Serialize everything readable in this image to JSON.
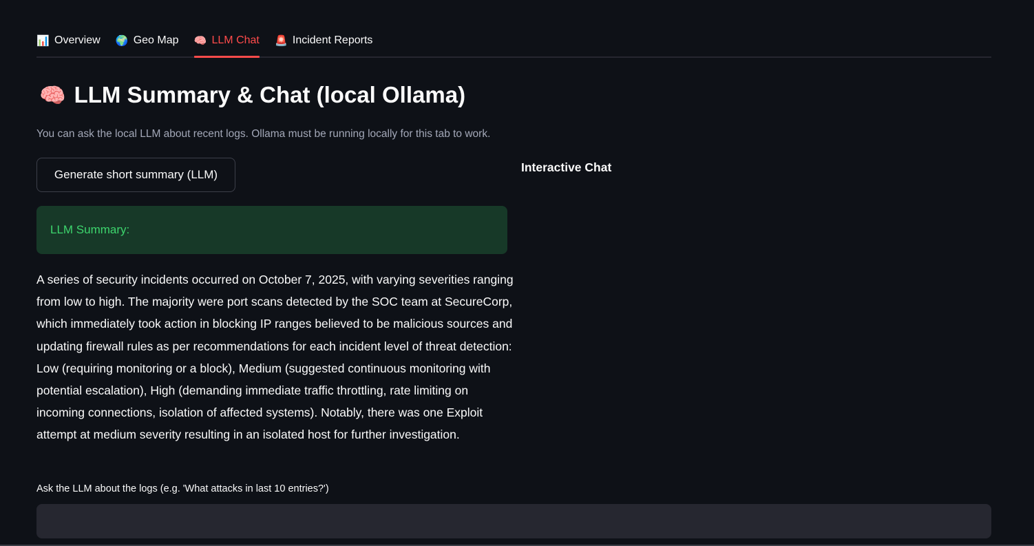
{
  "tabs": [
    {
      "icon": "bar-chart-icon",
      "glyph": "📊",
      "label": "Overview",
      "active": false
    },
    {
      "icon": "globe-icon",
      "glyph": "🌍",
      "label": "Geo Map",
      "active": false
    },
    {
      "icon": "brain-icon",
      "glyph": "🧠",
      "label": "LLM Chat",
      "active": true
    },
    {
      "icon": "siren-icon",
      "glyph": "🚨",
      "label": "Incident Reports",
      "active": false
    }
  ],
  "header": {
    "icon_glyph": "🧠",
    "title": "LLM Summary & Chat (local Ollama)",
    "caption": "You can ask the local LLM about recent logs. Ollama must be running locally for this tab to work."
  },
  "summary": {
    "button_label": "Generate short summary (LLM)",
    "box_label": "LLM Summary:",
    "text": "A series of security incidents occurred on October 7, 2025, with varying severities ranging from low to high. The majority were port scans detected by the SOC team at SecureCorp, which immediately took action in blocking IP ranges believed to be malicious sources and updating firewall rules as per recommendations for each incident level of threat detection: Low (requiring monitoring or a block), Medium (suggested continuous monitoring with potential escalation), High (demanding immediate traffic throttling, rate limiting on incoming connections, isolation of affected systems). Notably, there was one Exploit attempt at medium severity resulting in an isolated host for further investigation."
  },
  "chat": {
    "header": "Interactive Chat",
    "input_label": "Ask the LLM about the logs (e.g. 'What attacks in last 10 entries?')",
    "input_value": "",
    "input_placeholder": ""
  },
  "colors": {
    "background": "#0e1117",
    "accent": "#ff4b4b",
    "success_bg": "#173928",
    "success_text": "#3dd56d",
    "input_bg": "#262730"
  }
}
